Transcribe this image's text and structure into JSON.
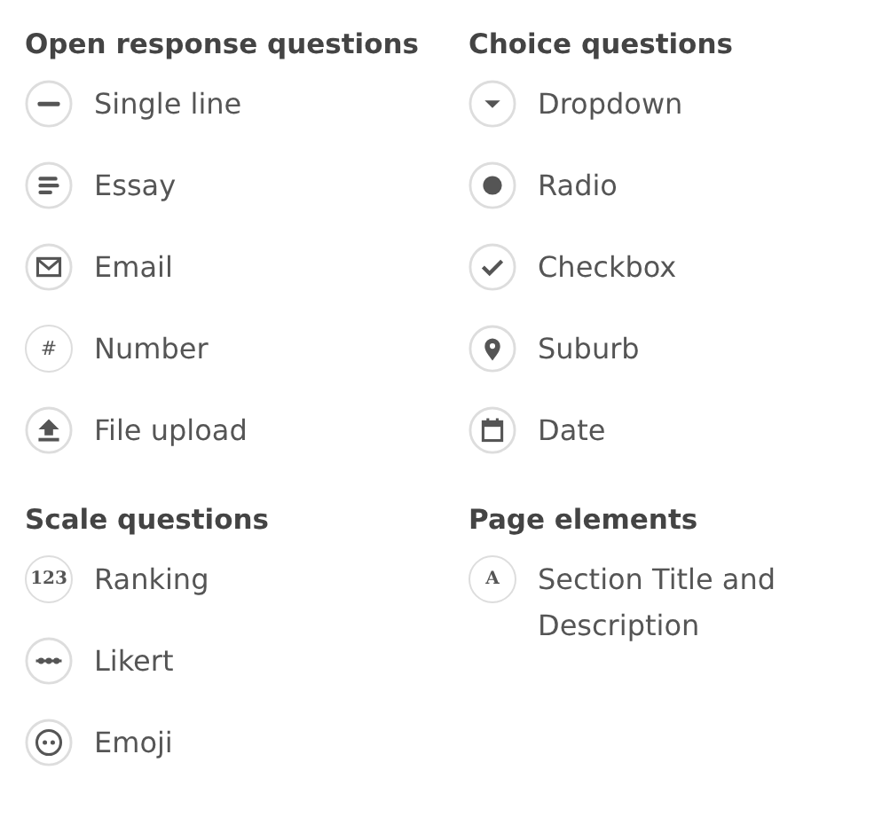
{
  "sections": [
    {
      "title": "Open response questions",
      "items": [
        {
          "kind": "single-line",
          "label": "Single line"
        },
        {
          "kind": "essay",
          "label": "Essay"
        },
        {
          "kind": "email",
          "label": "Email"
        },
        {
          "kind": "number",
          "label": "Number",
          "glyph": "#"
        },
        {
          "kind": "upload",
          "label": "File upload"
        }
      ]
    },
    {
      "title": "Choice questions",
      "items": [
        {
          "kind": "dropdown",
          "label": "Dropdown"
        },
        {
          "kind": "radio",
          "label": "Radio"
        },
        {
          "kind": "checkbox",
          "label": "Checkbox"
        },
        {
          "kind": "location",
          "label": "Suburb"
        },
        {
          "kind": "date",
          "label": "Date"
        }
      ]
    },
    {
      "title": "Scale questions",
      "items": [
        {
          "kind": "ranking",
          "label": "Ranking",
          "glyph": "123"
        },
        {
          "kind": "likert",
          "label": "Likert"
        },
        {
          "kind": "emoji",
          "label": "Emoji"
        }
      ]
    },
    {
      "title": "Page elements",
      "items": [
        {
          "kind": "section-title",
          "label": "Section Title and Description",
          "glyph": "A"
        }
      ]
    }
  ]
}
